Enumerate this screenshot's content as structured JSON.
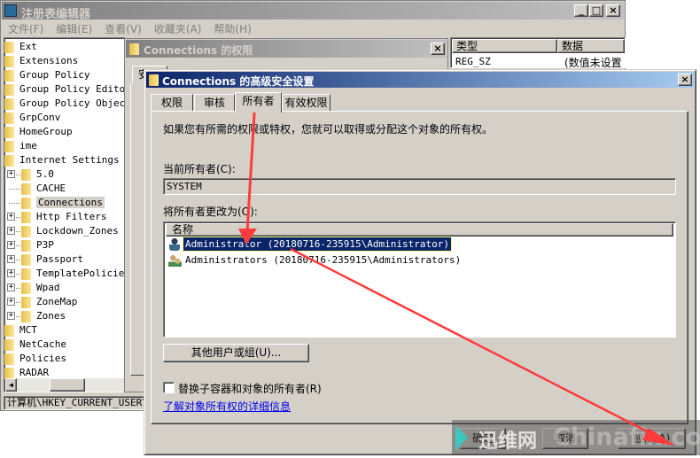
{
  "regedit": {
    "title": "注册表编辑器",
    "menu": [
      "文件(F)",
      "编辑(E)",
      "查看(V)",
      "收藏夹(A)",
      "帮助(H)"
    ],
    "tree": [
      {
        "label": "Ext",
        "level": 0
      },
      {
        "label": "Extensions",
        "level": 0
      },
      {
        "label": "Group Policy",
        "level": 0
      },
      {
        "label": "Group Policy Editor",
        "level": 0
      },
      {
        "label": "Group Policy Objects",
        "level": 0
      },
      {
        "label": "GrpConv",
        "level": 0
      },
      {
        "label": "HomeGroup",
        "level": 0
      },
      {
        "label": "ime",
        "level": 0
      },
      {
        "label": "Internet Settings",
        "level": 0
      },
      {
        "label": "5.0",
        "level": 1,
        "expandable": true
      },
      {
        "label": "CACHE",
        "level": 1
      },
      {
        "label": "Connections",
        "level": 1,
        "selected": true
      },
      {
        "label": "Http Filters",
        "level": 1,
        "expandable": true
      },
      {
        "label": "Lockdown_Zones",
        "level": 1,
        "expandable": true
      },
      {
        "label": "P3P",
        "level": 1,
        "expandable": true
      },
      {
        "label": "Passport",
        "level": 1,
        "expandable": true
      },
      {
        "label": "TemplatePolicies",
        "level": 1,
        "expandable": true
      },
      {
        "label": "Wpad",
        "level": 1,
        "expandable": true
      },
      {
        "label": "ZoneMap",
        "level": 1,
        "expandable": true
      },
      {
        "label": "Zones",
        "level": 1,
        "expandable": true
      },
      {
        "label": "MCT",
        "level": 0
      },
      {
        "label": "NetCache",
        "level": 0
      },
      {
        "label": "Policies",
        "level": 0
      },
      {
        "label": "RADAR",
        "level": 0
      }
    ],
    "columns": [
      "类型",
      "数据"
    ],
    "row": {
      "type": "REG_SZ",
      "data": "(数值未设置"
    },
    "status": "计算机\\HKEY_CURRENT_USER\\"
  },
  "perm_dialog": {
    "title": "Connections 的权限",
    "tab_fragment": "安"
  },
  "adv_dialog": {
    "title": "Connections 的高级安全设置",
    "tabs": [
      "权限",
      "审核",
      "所有者",
      "有效权限"
    ],
    "active_tab": "所有者",
    "intro": "如果您有所需的权限或特权，您就可以取得或分配这个对象的所有权。",
    "current_owner_label": "当前所有者(C):",
    "current_owner": "SYSTEM",
    "change_label": "将所有者更改为(O):",
    "list_header": "名称",
    "owners": [
      {
        "name": "Administrator (20180716-235915\\Administrator)",
        "icon": "user-icon",
        "selected": true
      },
      {
        "name": "Administrators (20180716-235915\\Administrators)",
        "icon": "group-icon"
      }
    ],
    "other_users_button": "其他用户或组(U)...",
    "replace_checkbox": "替换子容器和对象的所有者(R)",
    "replace_checked": false,
    "link": "了解对象所有权的详细信息",
    "ok": "确定",
    "cancel": "取消",
    "apply": "应用(A)"
  },
  "watermark": {
    "cn": "迅维网",
    "en": "Chinafix.com"
  },
  "colors": {
    "title_active": "#0a246a",
    "title_active_end": "#a6caf0",
    "selection": "#0a246a",
    "annotation": "#ff3b3b",
    "link": "#0000ee"
  }
}
